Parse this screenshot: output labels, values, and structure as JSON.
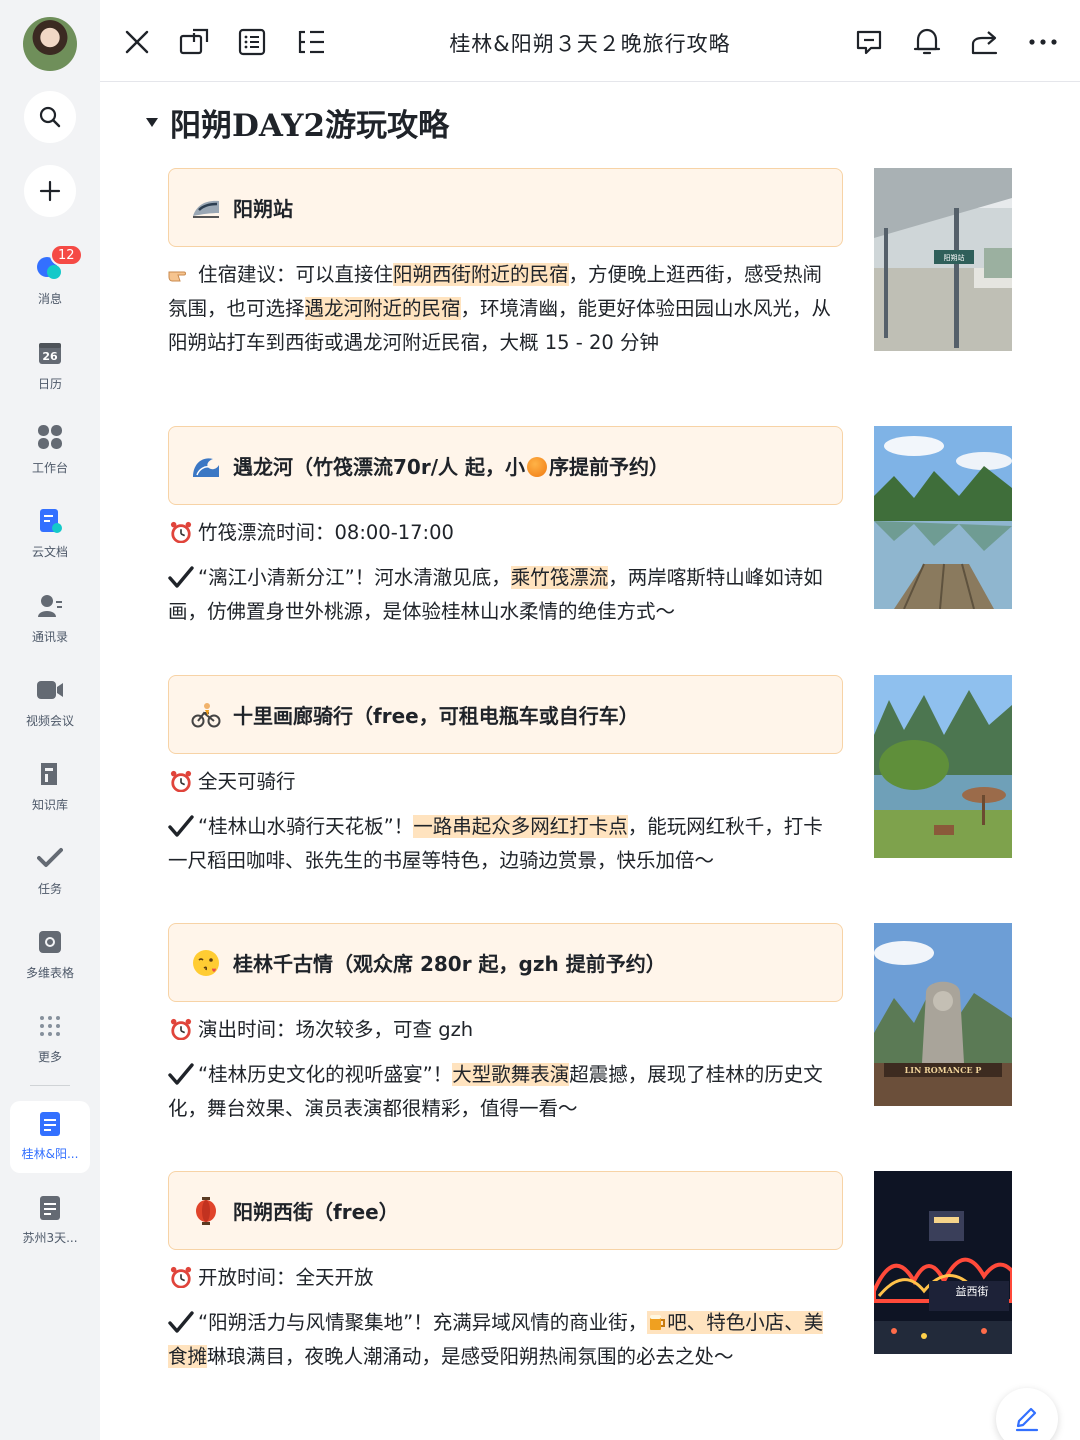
{
  "sidebar": {
    "badge_count": "12",
    "items": [
      {
        "label": "消息",
        "icon": "message-icon"
      },
      {
        "label": "日历",
        "icon": "calendar-icon",
        "day": "26"
      },
      {
        "label": "工作台",
        "icon": "workspace-icon"
      },
      {
        "label": "云文档",
        "icon": "cloud-doc-icon"
      },
      {
        "label": "通讯录",
        "icon": "contacts-icon"
      },
      {
        "label": "视频会议",
        "icon": "video-meeting-icon"
      },
      {
        "label": "知识库",
        "icon": "knowledge-base-icon"
      },
      {
        "label": "任务",
        "icon": "task-icon"
      },
      {
        "label": "多维表格",
        "icon": "base-table-icon"
      },
      {
        "label": "更多",
        "icon": "more-dots-icon"
      }
    ],
    "open_docs": [
      {
        "label": "桂林&阳...",
        "active": true
      },
      {
        "label": "苏州3天..."
      }
    ]
  },
  "topbar": {
    "title": "桂林&阳朔３天２晚旅行攻略"
  },
  "content": {
    "heading": "阳朔DAY2游玩攻略",
    "sections": [
      {
        "callout": "阳朔站",
        "emoji": "train-icon",
        "p1_a": "住宿建议：可以直接住",
        "p1_hl1": "阳朔西街附近的民宿",
        "p1_b": "，方便晚上逛西街，感受热闹氛围，也可选择",
        "p1_hl2": "遇龙河附近的民宿",
        "p1_c": "，环境清幽，能更好体验田园山水风光，从阳朔站打车到西街或遇龙河附近民宿，大概 15 - 20 分钟"
      },
      {
        "callout_a": "遇龙河（竹筏漂流70r/人 起，小",
        "callout_b": "序提前予约）",
        "emoji": "wave-icon",
        "time": "竹筏漂流时间：08:00-17:00",
        "p_a": "“漓江小清新分江”！河水清澈见底，",
        "p_hl": "乘竹筏漂流",
        "p_b": "，两岸喀斯特山峰如诗如画，仿佛置身世外桃源，是体验桂林山水柔情的绝佳方式～"
      },
      {
        "callout": "十里画廊骑行（free，可租电瓶车或自行车）",
        "emoji": "cyclist-icon",
        "time": "全天可骑行",
        "p_a": "“桂林山水骑行天花板”！",
        "p_hl": "一路串起众多网红打卡点",
        "p_b": "，能玩网红秋千，打卡一尺稻田咖啡、张先生的书屋等特色，边骑边赏景，快乐加倍～"
      },
      {
        "callout": "桂林千古情（观众席 280r 起，gzh 提前予约）",
        "emoji": "kiss-face-icon",
        "time": "演出时间：场次较多，可查 gzh",
        "p_a": "“桂林历史文化的视听盛宴”！",
        "p_hl": "大型歌舞表演",
        "p_b": "超震撼，展现了桂林的历史文化，舞台效果、演员表演都很精彩，值得一看～"
      },
      {
        "callout": "阳朔西街（free）",
        "emoji": "lantern-icon",
        "time": "开放时间：全天开放",
        "p_a": "“阳朔活力与风情聚集地”！充满异域风情的商业街，",
        "p_hl1": "吧、特色小店、",
        "p_hl2": "美食摊",
        "p_b": "琳琅满目，夜晚人潮涌动，是感受阳朔热闹氛围的必去之处～"
      }
    ],
    "photo_texts": {
      "station_sign": "阳朔站",
      "romance": "LIN ROMANCE P",
      "street": "益西街"
    }
  }
}
